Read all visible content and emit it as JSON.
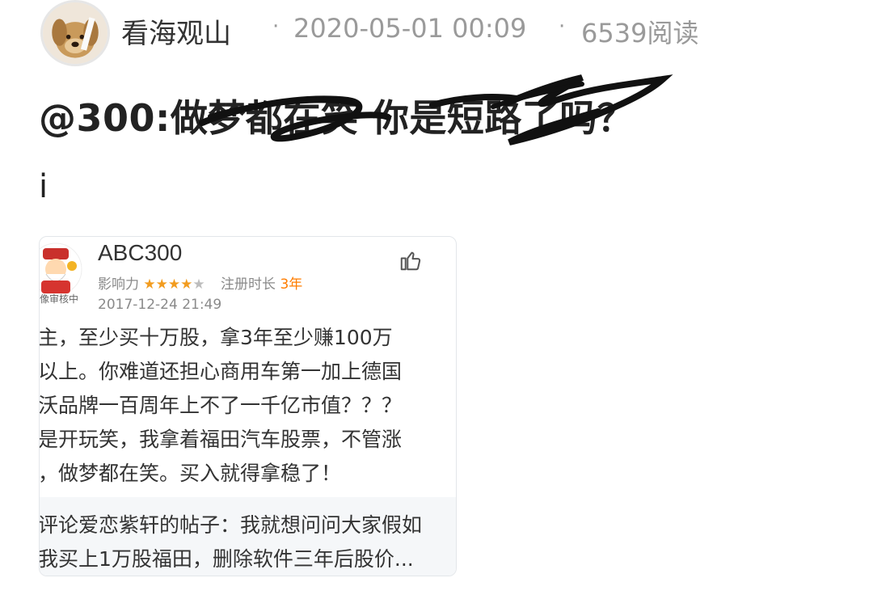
{
  "post": {
    "author": "看海观山",
    "separator": "·",
    "datetime": "2020-05-01 00:09",
    "reads": "6539阅读",
    "title": "@300:做梦都在笑 你是短路了吗？",
    "body": "i"
  },
  "quoted_comment": {
    "avatar_label": "像审核中",
    "username": "ABC300",
    "influence_label": "影响力",
    "stars_filled": "★★★★",
    "stars_empty": "★",
    "rating": 4,
    "registration_label": "注册时长",
    "registration_value": "3年",
    "date": "2017-12-24 21:49",
    "lines": [
      "主，至少买十万股，拿3年至少赚100万",
      "以上。你难道还担心商用车第一加上德国",
      "沃品牌一百周年上不了一千亿市值？？？",
      "是开玩笑，我拿着福田汽车股票，不管涨",
      "，做梦都在笑。买入就得拿稳了！"
    ],
    "context_lines": [
      "评论爱恋紫轩的帖子：我就想问问大家假如",
      "我买上1万股福田，删除软件三年后股价..."
    ]
  },
  "colors": {
    "meta": "#9a9a9a",
    "star": "#f29c1f",
    "accent": "#ff7d00",
    "card_footer_bg": "#f5f7f9"
  }
}
